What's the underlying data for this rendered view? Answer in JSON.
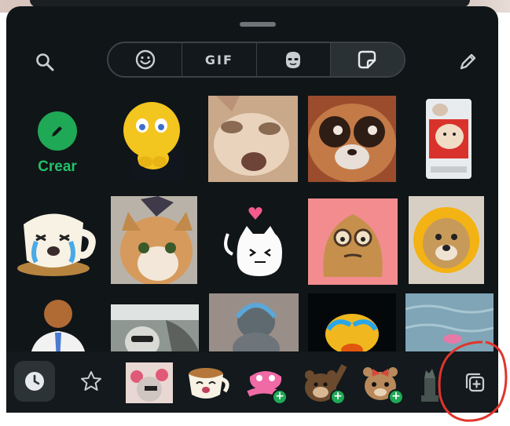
{
  "tabs": [
    {
      "icon": "emoji-icon",
      "active": false
    },
    {
      "label": "GIF",
      "active": false
    },
    {
      "icon": "avatar-icon",
      "active": false
    },
    {
      "icon": "sticker-icon",
      "active": true
    }
  ],
  "grid": {
    "create_label": "Crear",
    "stickers": [
      {
        "name": "sticker-emoji-begging"
      },
      {
        "name": "sticker-cat-closeup"
      },
      {
        "name": "sticker-sad-bushbaby"
      },
      {
        "name": "sticker-cat-in-phone"
      },
      {
        "name": "sticker-crying-cup"
      },
      {
        "name": "sticker-cat-party-hat"
      },
      {
        "name": "sticker-white-cat-heart"
      },
      {
        "name": "sticker-pou-glasses"
      },
      {
        "name": "sticker-dog-sunflower"
      },
      {
        "name": "sticker-dog-in-suit"
      },
      {
        "name": "sticker-car-sunglasses"
      },
      {
        "name": "sticker-blurry-cat-headphones"
      },
      {
        "name": "sticker-crying-duck"
      },
      {
        "name": "sticker-water-fish"
      }
    ]
  },
  "bottom": {
    "packs": [
      {
        "name": "pack-cat-grandma",
        "addable": false
      },
      {
        "name": "pack-coffee-cup",
        "addable": false
      },
      {
        "name": "pack-pink-cat",
        "addable": true
      },
      {
        "name": "pack-bear-wave",
        "addable": true
      },
      {
        "name": "pack-bear-bow",
        "addable": true
      },
      {
        "name": "pack-chess",
        "addable": false
      }
    ]
  },
  "colors": {
    "panel": "#101518",
    "accent": "#1fa855",
    "annotation": "#e0352b"
  }
}
